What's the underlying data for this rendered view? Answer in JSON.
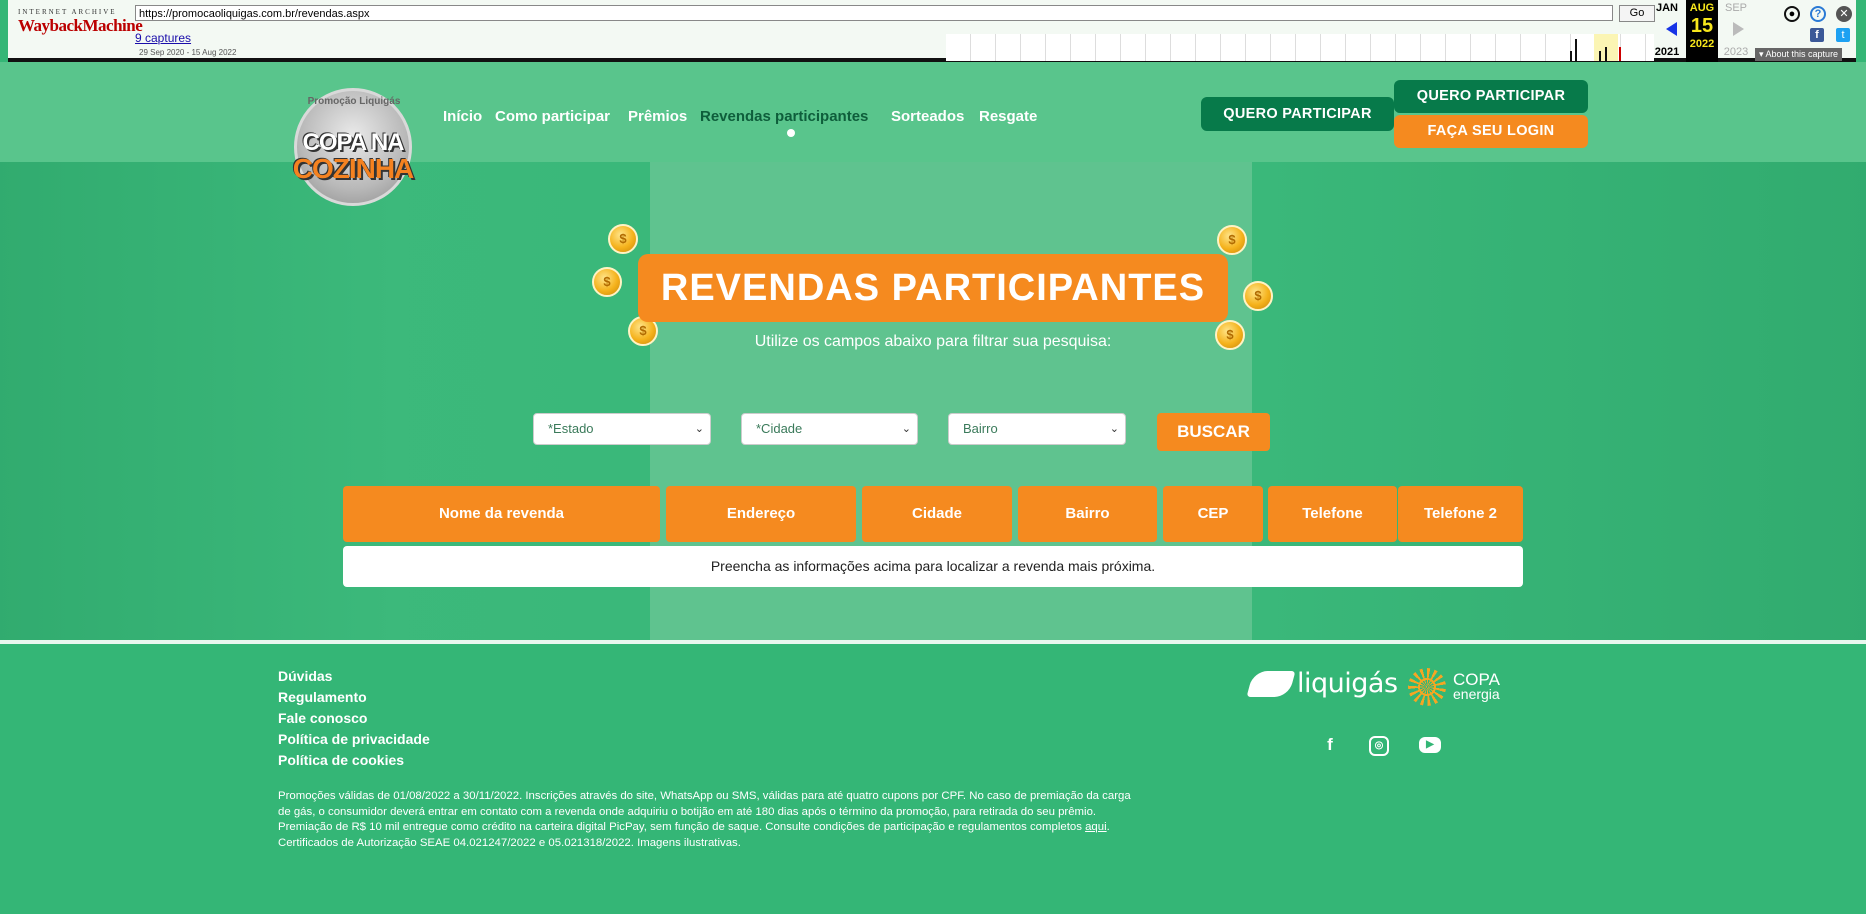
{
  "wayback": {
    "logo_top": "INTERNET ARCHIVE",
    "logo_main": "WaybackMachine",
    "url": "https://promocaoliquigas.com.br/revendas.aspx",
    "go_label": "Go",
    "captures_link": "9 captures",
    "date_range": "29 Sep 2020 - 15 Aug 2022",
    "prev_month": "JAN",
    "prev_year": "2021",
    "cur_month": "AUG",
    "cur_day": "15",
    "cur_year": "2022",
    "next_month": "SEP",
    "next_year": "2023",
    "about_label": "▾ About this capture"
  },
  "brand": {
    "top_text": "Promoção Liquigás",
    "line1": "COPA NA",
    "line2": "COZINHA"
  },
  "nav": {
    "items": [
      "Início",
      "Como participar",
      "Prêmios",
      "Revendas participantes",
      "Sorteados",
      "Resgate"
    ],
    "active_index": 3
  },
  "header_buttons": {
    "quero_participar_1": "QUERO PARTICIPAR",
    "quero_participar_2": "QUERO PARTICIPAR",
    "login": "FAÇA SEU LOGIN"
  },
  "main": {
    "title": "REVENDAS PARTICIPANTES",
    "subtitle": "Utilize os campos abaixo para filtrar sua pesquisa:",
    "filters": {
      "estado": "*Estado",
      "cidade": "*Cidade",
      "bairro": "Bairro"
    },
    "search_button": "BUSCAR",
    "table_headers": [
      "Nome da revenda",
      "Endereço",
      "Cidade",
      "Bairro",
      "CEP",
      "Telefone",
      "Telefone 2"
    ],
    "empty_message": "Preencha as informações acima para localizar a revenda mais próxima."
  },
  "footer": {
    "links": [
      "Dúvidas",
      "Regulamento",
      "Fale conosco",
      "Política de privacidade",
      "Política de cookies"
    ],
    "legal_before_link": "Promoções válidas de 01/08/2022 a 30/11/2022. Inscrições através do site, WhatsApp ou SMS, válidas para até quatro cupons por CPF. No caso de premiação da carga de gás, o consumidor deverá entrar em contato com a revenda onde adquiriu o botijão em até 180 dias após o término da promoção, para retirada do seu prêmio. Premiação de R$ 10 mil entregue como crédito na carteira digital PicPay, sem função de saque. Consulte condições de participação e regulamentos completos ",
    "legal_link": "aqui",
    "legal_after_link": ". Certificados de Autorização SEAE 04.021247/2022 e 05.021318/2022. Imagens ilustrativas.",
    "partner1": "liquigás",
    "partner2_line1": "COPA",
    "partner2_line2": "energia",
    "social_icons": [
      "facebook-icon",
      "instagram-icon",
      "youtube-icon"
    ]
  },
  "colors": {
    "green_bg": "#34b676",
    "header_green": "#59c58c",
    "dark_green": "#077a4a",
    "orange": "#f58a1f"
  }
}
